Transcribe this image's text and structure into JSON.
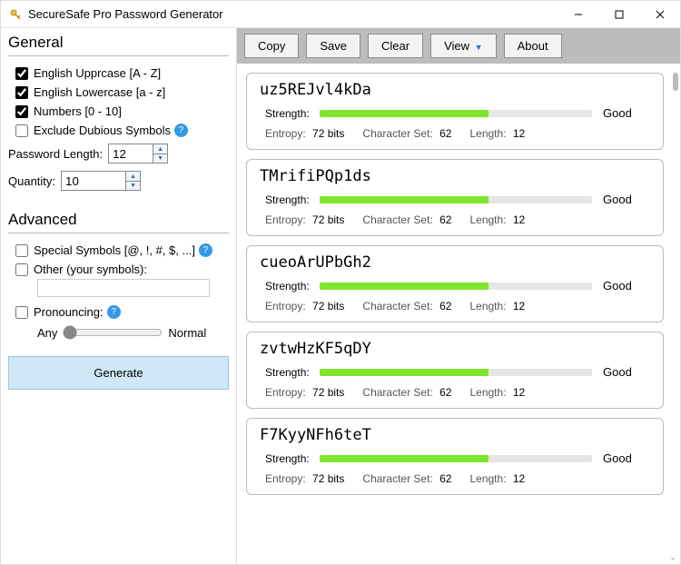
{
  "window": {
    "title": "SecureSafe Pro Password Generator"
  },
  "sidebar": {
    "general": {
      "header": "General",
      "uppercase": {
        "checked": true,
        "label": "English Upprcase [A - Z]"
      },
      "lowercase": {
        "checked": true,
        "label": "English Lowercase [a - z]"
      },
      "numbers": {
        "checked": true,
        "label": "Numbers [0 - 10]"
      },
      "exclude": {
        "checked": false,
        "label": "Exclude Dubious Symbols"
      },
      "password_length": {
        "label": "Password Length:",
        "value": "12"
      },
      "quantity": {
        "label": "Quantity:",
        "value": "10"
      }
    },
    "advanced": {
      "header": "Advanced",
      "special": {
        "checked": false,
        "label": "Special Symbols [@, !, #, $, ...]"
      },
      "other": {
        "checked": false,
        "label": "Other (your symbols):",
        "value": ""
      },
      "pronouncing": {
        "checked": false,
        "label": "Pronouncing:"
      },
      "slider": {
        "left": "Any",
        "right": "Normal"
      }
    },
    "generate_label": "Generate"
  },
  "toolbar": {
    "copy": "Copy",
    "save": "Save",
    "clear": "Clear",
    "view": "View",
    "about": "About"
  },
  "card_labels": {
    "strength": "Strength:",
    "entropy": "Entropy:",
    "entropy_unit": "bits",
    "charset": "Character Set:",
    "length": "Length:"
  },
  "results": [
    {
      "password": "uz5REJvl4kDa",
      "strength_text": "Good",
      "entropy": "72",
      "charset": "62",
      "length": "12"
    },
    {
      "password": "TMrifiPQp1ds",
      "strength_text": "Good",
      "entropy": "72",
      "charset": "62",
      "length": "12"
    },
    {
      "password": "cueoArUPbGh2",
      "strength_text": "Good",
      "entropy": "72",
      "charset": "62",
      "length": "12"
    },
    {
      "password": "zvtwHzKF5qDY",
      "strength_text": "Good",
      "entropy": "72",
      "charset": "62",
      "length": "12"
    },
    {
      "password": "F7KyyNFh6teT",
      "strength_text": "Good",
      "entropy": "72",
      "charset": "62",
      "length": "12"
    }
  ],
  "help_glyph": "?"
}
